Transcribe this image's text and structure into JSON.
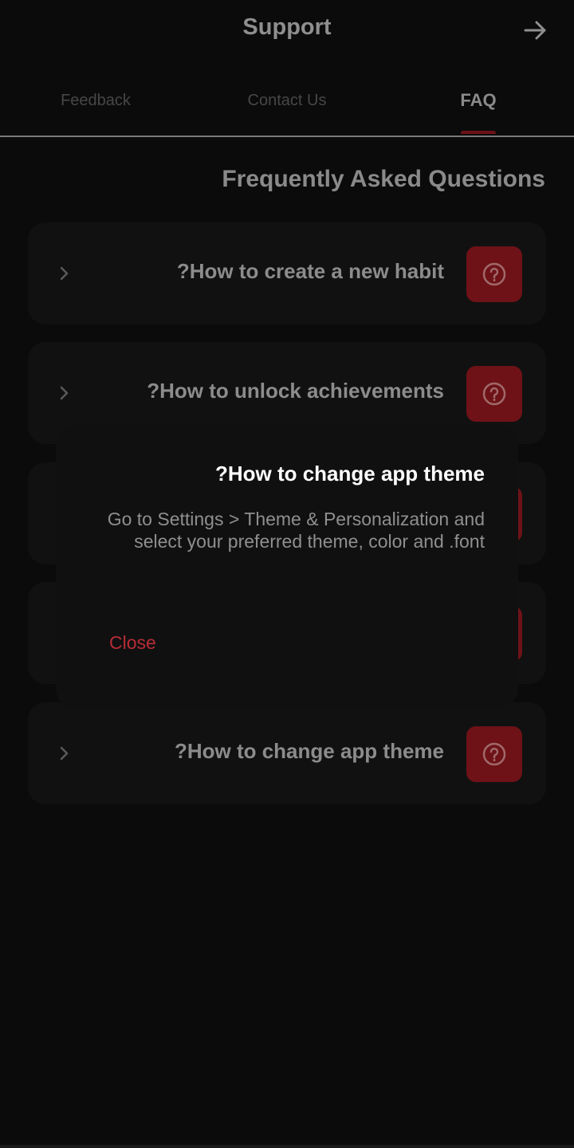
{
  "header": {
    "title": "Support",
    "back_icon": "arrow-right-icon"
  },
  "tabs": [
    {
      "label": "Feedback",
      "active": false
    },
    {
      "label": "Contact Us",
      "active": false
    },
    {
      "label": "FAQ",
      "active": true
    }
  ],
  "section_title": "Frequently Asked Questions",
  "faq_items": [
    {
      "question": "?How to create a new habit",
      "icon": "question-circle-icon"
    },
    {
      "question": "?How to unlock achievements",
      "icon": "question-circle-icon"
    },
    {
      "question": "",
      "icon": "question-circle-icon"
    },
    {
      "question": "",
      "icon": "question-circle-icon"
    },
    {
      "question": "?How to change app theme",
      "icon": "question-circle-icon"
    }
  ],
  "dialog": {
    "title": "?How to change app theme",
    "body": "Go to Settings > Theme & Personalization and select your preferred theme, color and .font",
    "close_label": "Close"
  },
  "colors": {
    "background": "#0b0b0b",
    "accent": "#b82c36",
    "icon_bg": "#6e1217",
    "card": "#111111"
  }
}
